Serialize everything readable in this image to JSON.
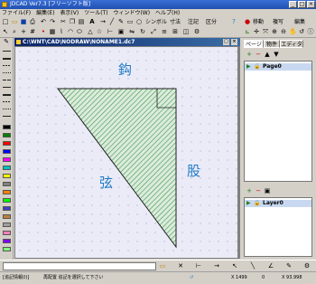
{
  "window": {
    "title": "JDCAD Ver7.3 [フリーソフト版]"
  },
  "menu": [
    "ファイル(F)",
    "編集(E)",
    "表示(V)",
    "ツール(T)",
    "ウィンドウ(W)",
    "ヘルプ(H)"
  ],
  "toolbar": {
    "symbol_label": "シンボル",
    "dim_label": "寸法",
    "note_label": "注記",
    "sep_label": "区分",
    "move_label": "移動",
    "dup_label": "複写",
    "edit_label": "編集",
    "text_a": "A"
  },
  "document": {
    "title": "C:\\WNT\\CAD\\NODRAW\\NONAME1.dc7",
    "labels": {
      "top": "鈎",
      "right": "股",
      "hypotenuse": "弦"
    }
  },
  "right_panel": {
    "tabs": [
      "ページ",
      "物件",
      "エディタ"
    ],
    "pages": [
      "Page0"
    ],
    "layers": [
      "Layer0"
    ]
  },
  "statusbar": {
    "mode": "[追記情報(I)]",
    "message": "再配置 追記を選択して下さい",
    "coord1": "X 1499",
    "coord2": "0",
    "coord3": "X 93.998"
  },
  "colors": {
    "swatches": [
      "#000000",
      "#008000",
      "#ff0000",
      "#0000ff",
      "#ff00ff",
      "#00c0c0",
      "#ffff00",
      "#808080",
      "#ff8000",
      "#00ff00",
      "#4040c0",
      "#c08040",
      "#a0a0a0",
      "#ff80c0",
      "#8000ff",
      "#80ff80"
    ]
  }
}
